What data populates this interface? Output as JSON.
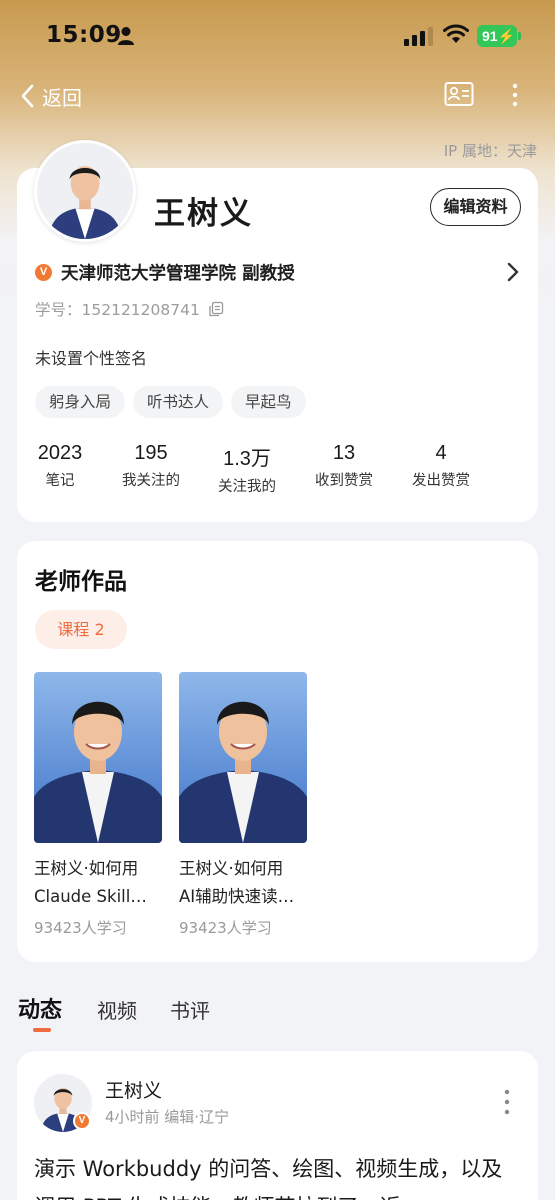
{
  "status_bar": {
    "time": "15:09",
    "battery": "91"
  },
  "nav": {
    "back_label": "返回",
    "ip_location": "IP 属地：天津"
  },
  "profile": {
    "name": "王树义",
    "edit_button": "编辑资料",
    "institution": "天津师范大学管理学院 副教授",
    "student_id": "学号：152121208741",
    "signature": "未设置个性签名",
    "tags": [
      "躬身入局",
      "听书达人",
      "早起鸟"
    ],
    "stats": [
      {
        "value": "2023",
        "label": "笔记"
      },
      {
        "value": "195",
        "label": "我关注的"
      },
      {
        "value": "1.3万",
        "label": "关注我的"
      },
      {
        "value": "13",
        "label": "收到赞赏"
      },
      {
        "value": "4",
        "label": "发出赞赏"
      }
    ]
  },
  "works": {
    "title": "老师作品",
    "course_pill": "课程 2",
    "courses": [
      {
        "title_line1": "王树义·如何用",
        "title_line2": "Claude Skill…",
        "learners": "93423人学习"
      },
      {
        "title_line1": "王树义·如何用",
        "title_line2": "AI辅助快速读…",
        "learners": "93423人学习"
      }
    ]
  },
  "tabs": [
    "动态",
    "视频",
    "书评"
  ],
  "feed": {
    "author": "王树义",
    "meta": "4小时前 编辑·辽宁",
    "text": "演示 Workbuddy 的问答、绘图、视频生成，以及调用 PPT 生成技能，教师节拉到了，近"
  },
  "colors": {
    "accent": "#f06a3e",
    "badge": "#f07a33",
    "header": "#c79a4f",
    "battery": "#33c759"
  },
  "icons": [
    "person-icon",
    "signal-icon",
    "wifi-icon",
    "battery-icon",
    "chevron-left-icon",
    "id-card-icon",
    "more-vertical-icon",
    "chevron-right-icon",
    "copy-icon",
    "verified-v-icon"
  ]
}
